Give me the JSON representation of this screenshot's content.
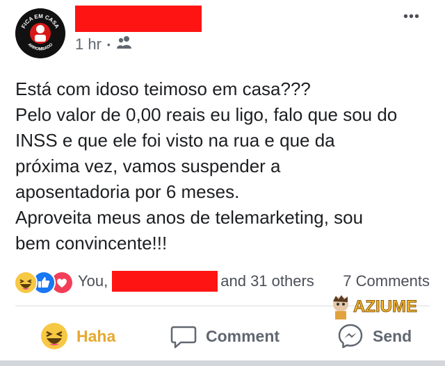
{
  "header": {
    "avatar_text_top": "FICA EM CASA",
    "avatar_text_bottom": "ARROMBADO",
    "author_name": "",
    "time": "1 hr",
    "separator": "•",
    "audience_icon": "friends-icon",
    "more_icon": "•••"
  },
  "post": {
    "lines": [
      "Está com idoso teimoso em casa???",
      "Pelo valor de 0,00 reais eu ligo, falo que sou do",
      "INSS e que ele foi visto na rua e que da",
      "próxima vez, vamos suspender a",
      "aposentadoria por 6 meses.",
      "Aproveita meus anos de telemarketing, sou",
      "bem convincente!!!"
    ]
  },
  "reactions": {
    "icons": [
      "haha-icon",
      "like-icon",
      "love-icon"
    ],
    "prefix": "You,",
    "suffix": "and 31 others",
    "comments": "7 Comments"
  },
  "watermark": {
    "text": "AZIUME"
  },
  "actions": {
    "haha_label": "Haha",
    "comment_label": "Comment",
    "send_label": "Send"
  },
  "colors": {
    "redaction": "#ff1414",
    "haha_accent": "#e5a82f",
    "like_blue": "#1877f2",
    "love_red": "#f33e58",
    "muted_text": "#606770"
  }
}
